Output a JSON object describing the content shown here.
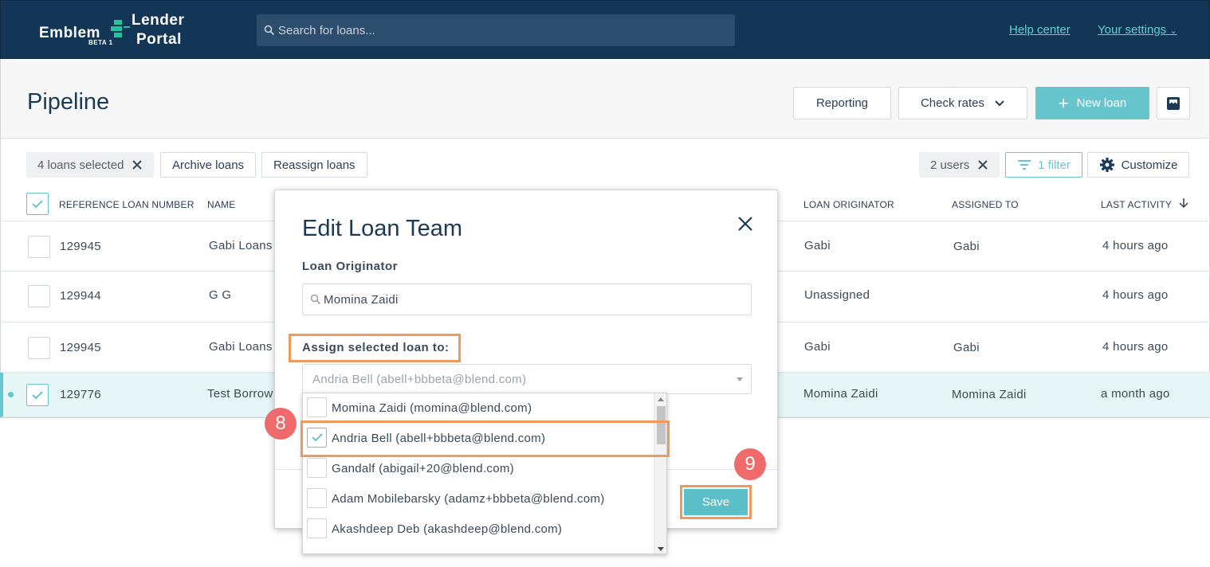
{
  "brand": {
    "left": "Emblem",
    "top": "Lender",
    "bottom": "Portal",
    "badge": "BETA 1"
  },
  "search": {
    "placeholder": "Search for loans..."
  },
  "nav": {
    "help": "Help center",
    "settings": "Your settings"
  },
  "page": {
    "title": "Pipeline",
    "reporting": "Reporting",
    "check_rates": "Check rates",
    "new_loan": "New loan"
  },
  "toolbar": {
    "selected": "4 loans selected",
    "archive": "Archive loans",
    "reassign": "Reassign loans",
    "users": "2 users",
    "filter": "1 filter",
    "customize": "Customize"
  },
  "table": {
    "headers": {
      "ref": "REFERENCE LOAN NUMBER",
      "name": "NAME",
      "originator": "LOAN ORIGINATOR",
      "assigned": "ASSIGNED TO",
      "activity": "LAST ACTIVITY"
    },
    "rows": [
      {
        "ref": "129945",
        "name": "Gabi Loans",
        "originator": "Gabi",
        "assigned": "Gabi",
        "activity": "4 hours ago"
      },
      {
        "ref": "129944",
        "name": "G G",
        "originator": "Unassigned",
        "assigned": "",
        "activity": "4 hours ago"
      },
      {
        "ref": "129945",
        "name": "Gabi Loans",
        "originator": "Gabi",
        "assigned": "Gabi",
        "activity": "4 hours ago"
      },
      {
        "ref": "129776",
        "name": "Test Borrow",
        "originator": "Momina Zaidi",
        "assigned": "Momina Zaidi",
        "activity": "a month ago"
      }
    ]
  },
  "modal": {
    "title": "Edit Loan Team",
    "originator_label": "Loan Originator",
    "originator_value": "Momina Zaidi",
    "assign_label": "Assign selected loan to:",
    "assign_value": "Andria Bell (abell+bbbeta@blend.com)",
    "save": "Save",
    "options": [
      "Momina Zaidi (momina@blend.com)",
      "Andria Bell (abell+bbbeta@blend.com)",
      "Gandalf (abigail+20@blend.com)",
      "Adam Mobilebarsky (adamz+bbbeta@blend.com)",
      "Akashdeep Deb (akashdeep@blend.com)"
    ]
  },
  "callouts": {
    "step8": "8",
    "step9": "9"
  },
  "colors": {
    "navy": "#133556",
    "teal": "#67c6cd",
    "highlight": "#ef9a5c",
    "callout": "#ef6b6b"
  }
}
